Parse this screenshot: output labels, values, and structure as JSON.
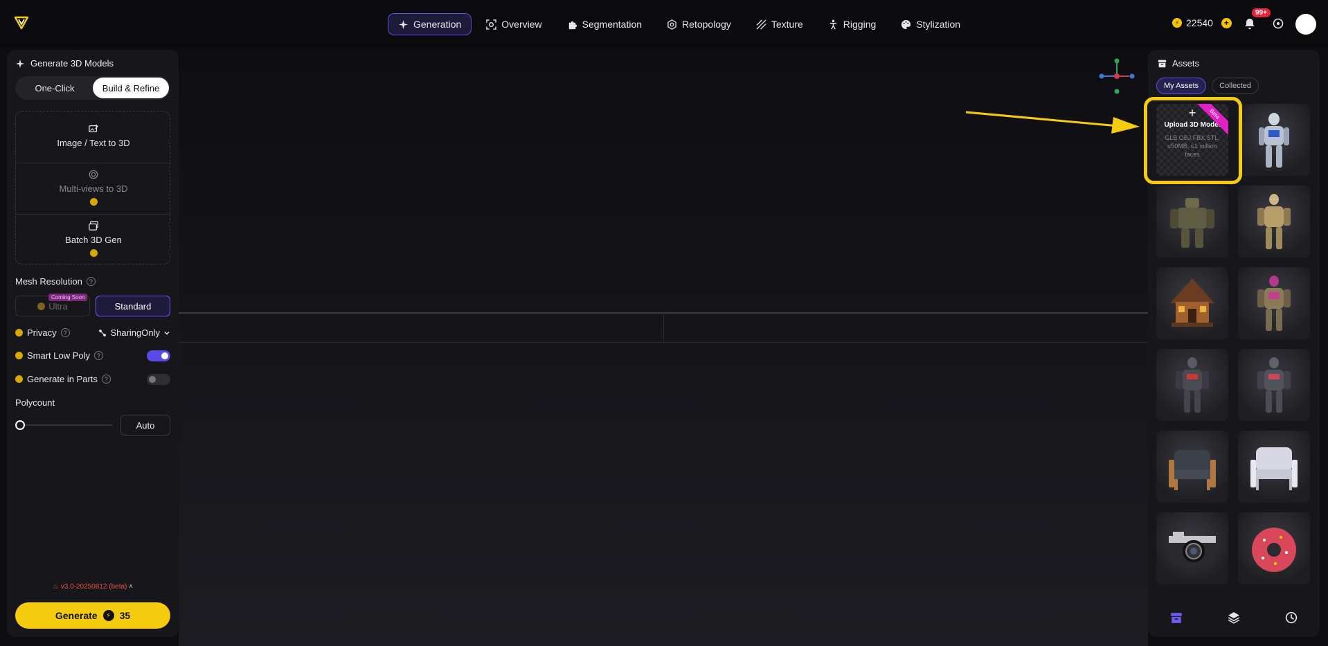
{
  "nav": {
    "items": [
      {
        "label": "Generation",
        "icon": "sparkle-icon",
        "active": true
      },
      {
        "label": "Overview",
        "icon": "scan-icon",
        "active": false
      },
      {
        "label": "Segmentation",
        "icon": "puzzle-icon",
        "active": false
      },
      {
        "label": "Retopology",
        "icon": "hexagon-icon",
        "active": false
      },
      {
        "label": "Texture",
        "icon": "texture-icon",
        "active": false
      },
      {
        "label": "Rigging",
        "icon": "figure-icon",
        "active": false
      },
      {
        "label": "Stylization",
        "icon": "palette-icon",
        "active": false
      }
    ]
  },
  "header": {
    "credits": "22540",
    "notifications_badge": "99+"
  },
  "left": {
    "title": "Generate 3D Models",
    "mode_oneclick": "One-Click",
    "mode_build": "Build & Refine",
    "opt_image_text": "Image / Text to 3D",
    "opt_multiview": "Multi-views to 3D",
    "opt_batch": "Batch 3D Gen",
    "mesh_resolution": "Mesh Resolution",
    "res_ultra": "Ultra",
    "coming_soon": "Coming Soon",
    "res_standard": "Standard",
    "privacy": "Privacy",
    "sharing": "SharingOnly",
    "smart_low_poly": "Smart Low Poly",
    "generate_parts": "Generate in Parts",
    "polycount": "Polycount",
    "polycount_value": "Auto",
    "version": "v3.0-20250812 (beta)",
    "generate": "Generate",
    "generate_cost": "35"
  },
  "assets": {
    "title": "Assets",
    "tab_my": "My Assets",
    "tab_collected": "Collected",
    "upload_title": "Upload 3D Model",
    "upload_desc": "GLB,OBJ,FBX,STL, ≤50MB, ≤1 million faces",
    "beta": "Beta"
  },
  "colors": {
    "accent": "#5b4ee0",
    "highlight": "#f5cb0f",
    "beta": "#e021c4"
  }
}
